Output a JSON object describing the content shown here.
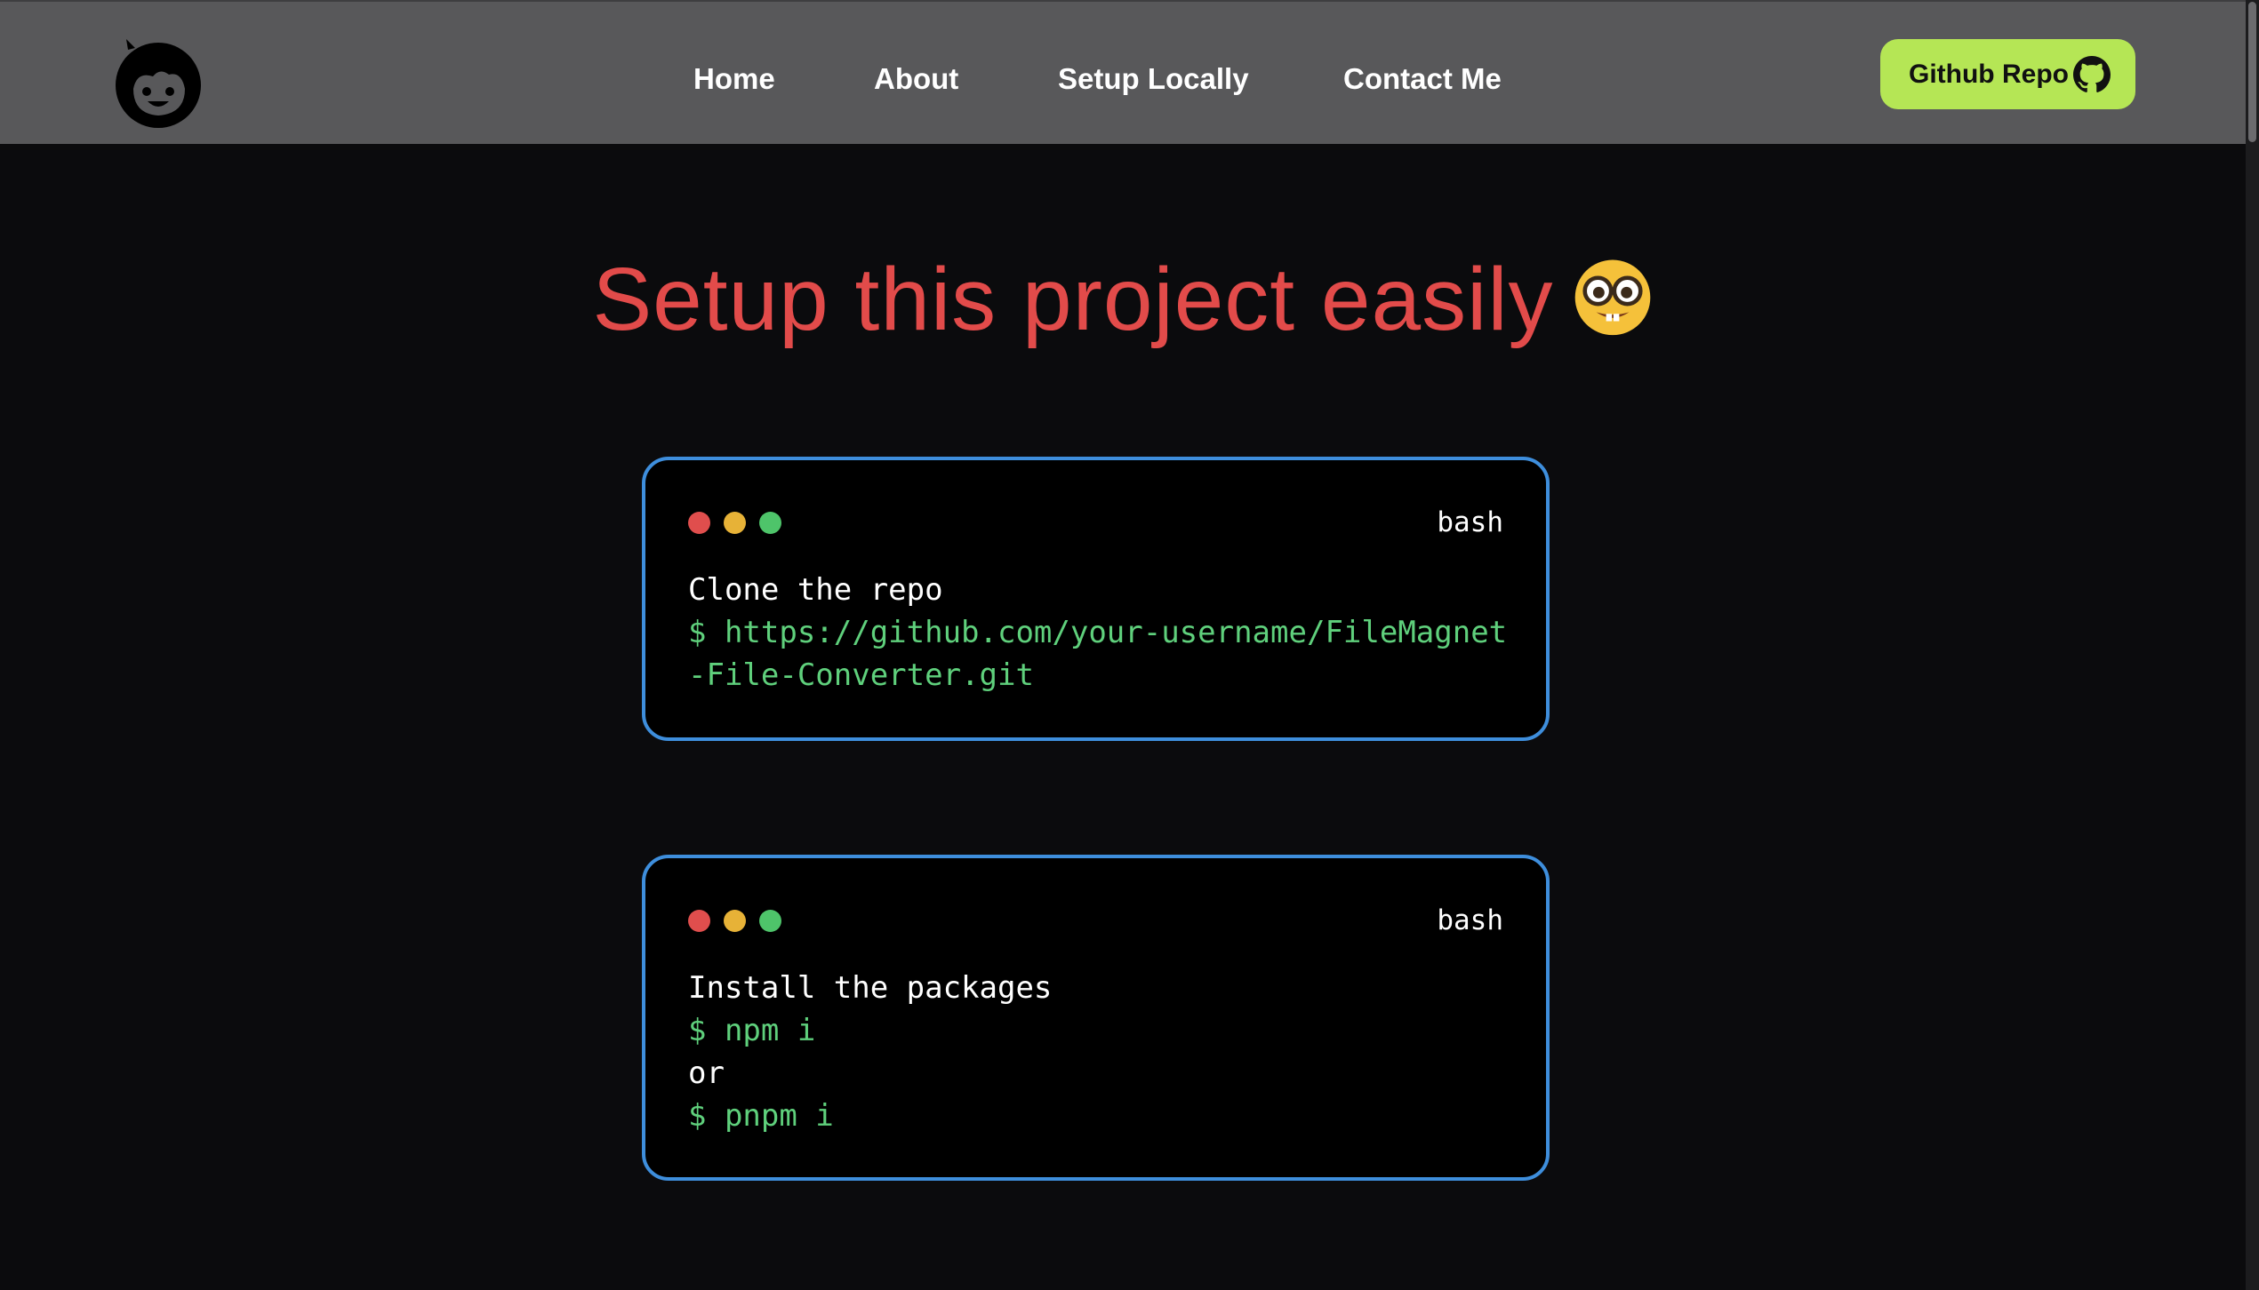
{
  "nav": {
    "links": [
      "Home",
      "About",
      "Setup Locally",
      "Contact Me"
    ],
    "github_label": "Github Repo"
  },
  "hero": {
    "title": "Setup this project easily"
  },
  "terminals": [
    {
      "lang": "bash",
      "description": "Clone the repo",
      "command": "$ https://github.com/your-username/FileMagnet-File-Converter.git"
    },
    {
      "lang": "bash",
      "description": "Install the packages",
      "command": "$ npm i",
      "separator": "or",
      "command2": "$ pnpm i"
    }
  ],
  "colors": {
    "accent_title": "#e24b4a",
    "github_button": "#b5e655",
    "terminal_border": "#3e8edc",
    "command_text": "#5fd07c"
  },
  "icons": [
    "boy-face-logo-icon",
    "github-icon",
    "nerd-face-emoji"
  ]
}
